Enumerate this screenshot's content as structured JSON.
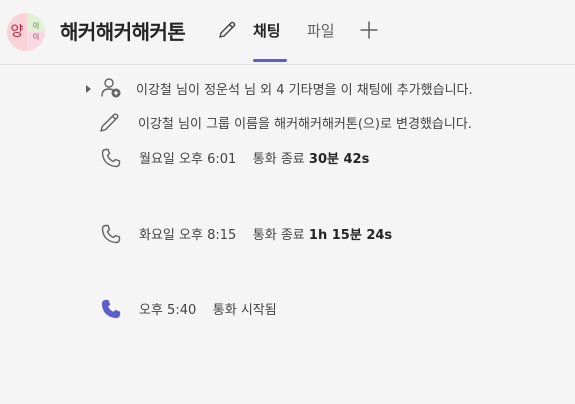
{
  "header": {
    "avatar_initial": "양",
    "avatar_top_right": "이",
    "avatar_bottom_right": "이",
    "title": "해커해커해커톤",
    "tabs": [
      {
        "label": "채팅",
        "active": true
      },
      {
        "label": "파일",
        "active": false
      }
    ],
    "accent_color": "#5b5fc7"
  },
  "events": [
    {
      "icon": "add-person-icon",
      "text": "이강철 님이 정운석 님 외 4 기타명을 이 채팅에 추가했습니다.",
      "expandable": true
    },
    {
      "icon": "pencil-icon",
      "text": "이강철 님이 그룹 이름을 해커해커해커톤(으)로 변경했습니다."
    },
    {
      "icon": "phone-icon",
      "time": "월요일 오후 6:01",
      "label": "통화 종료",
      "duration": "30분 42s"
    },
    {
      "icon": "phone-icon",
      "time": "화요일 오후 8:15",
      "label": "통화 종료",
      "duration": "1h 15분 24s"
    },
    {
      "icon": "phone-filled-icon",
      "time": "오후 5:40",
      "label": "통화 시작됨"
    }
  ]
}
